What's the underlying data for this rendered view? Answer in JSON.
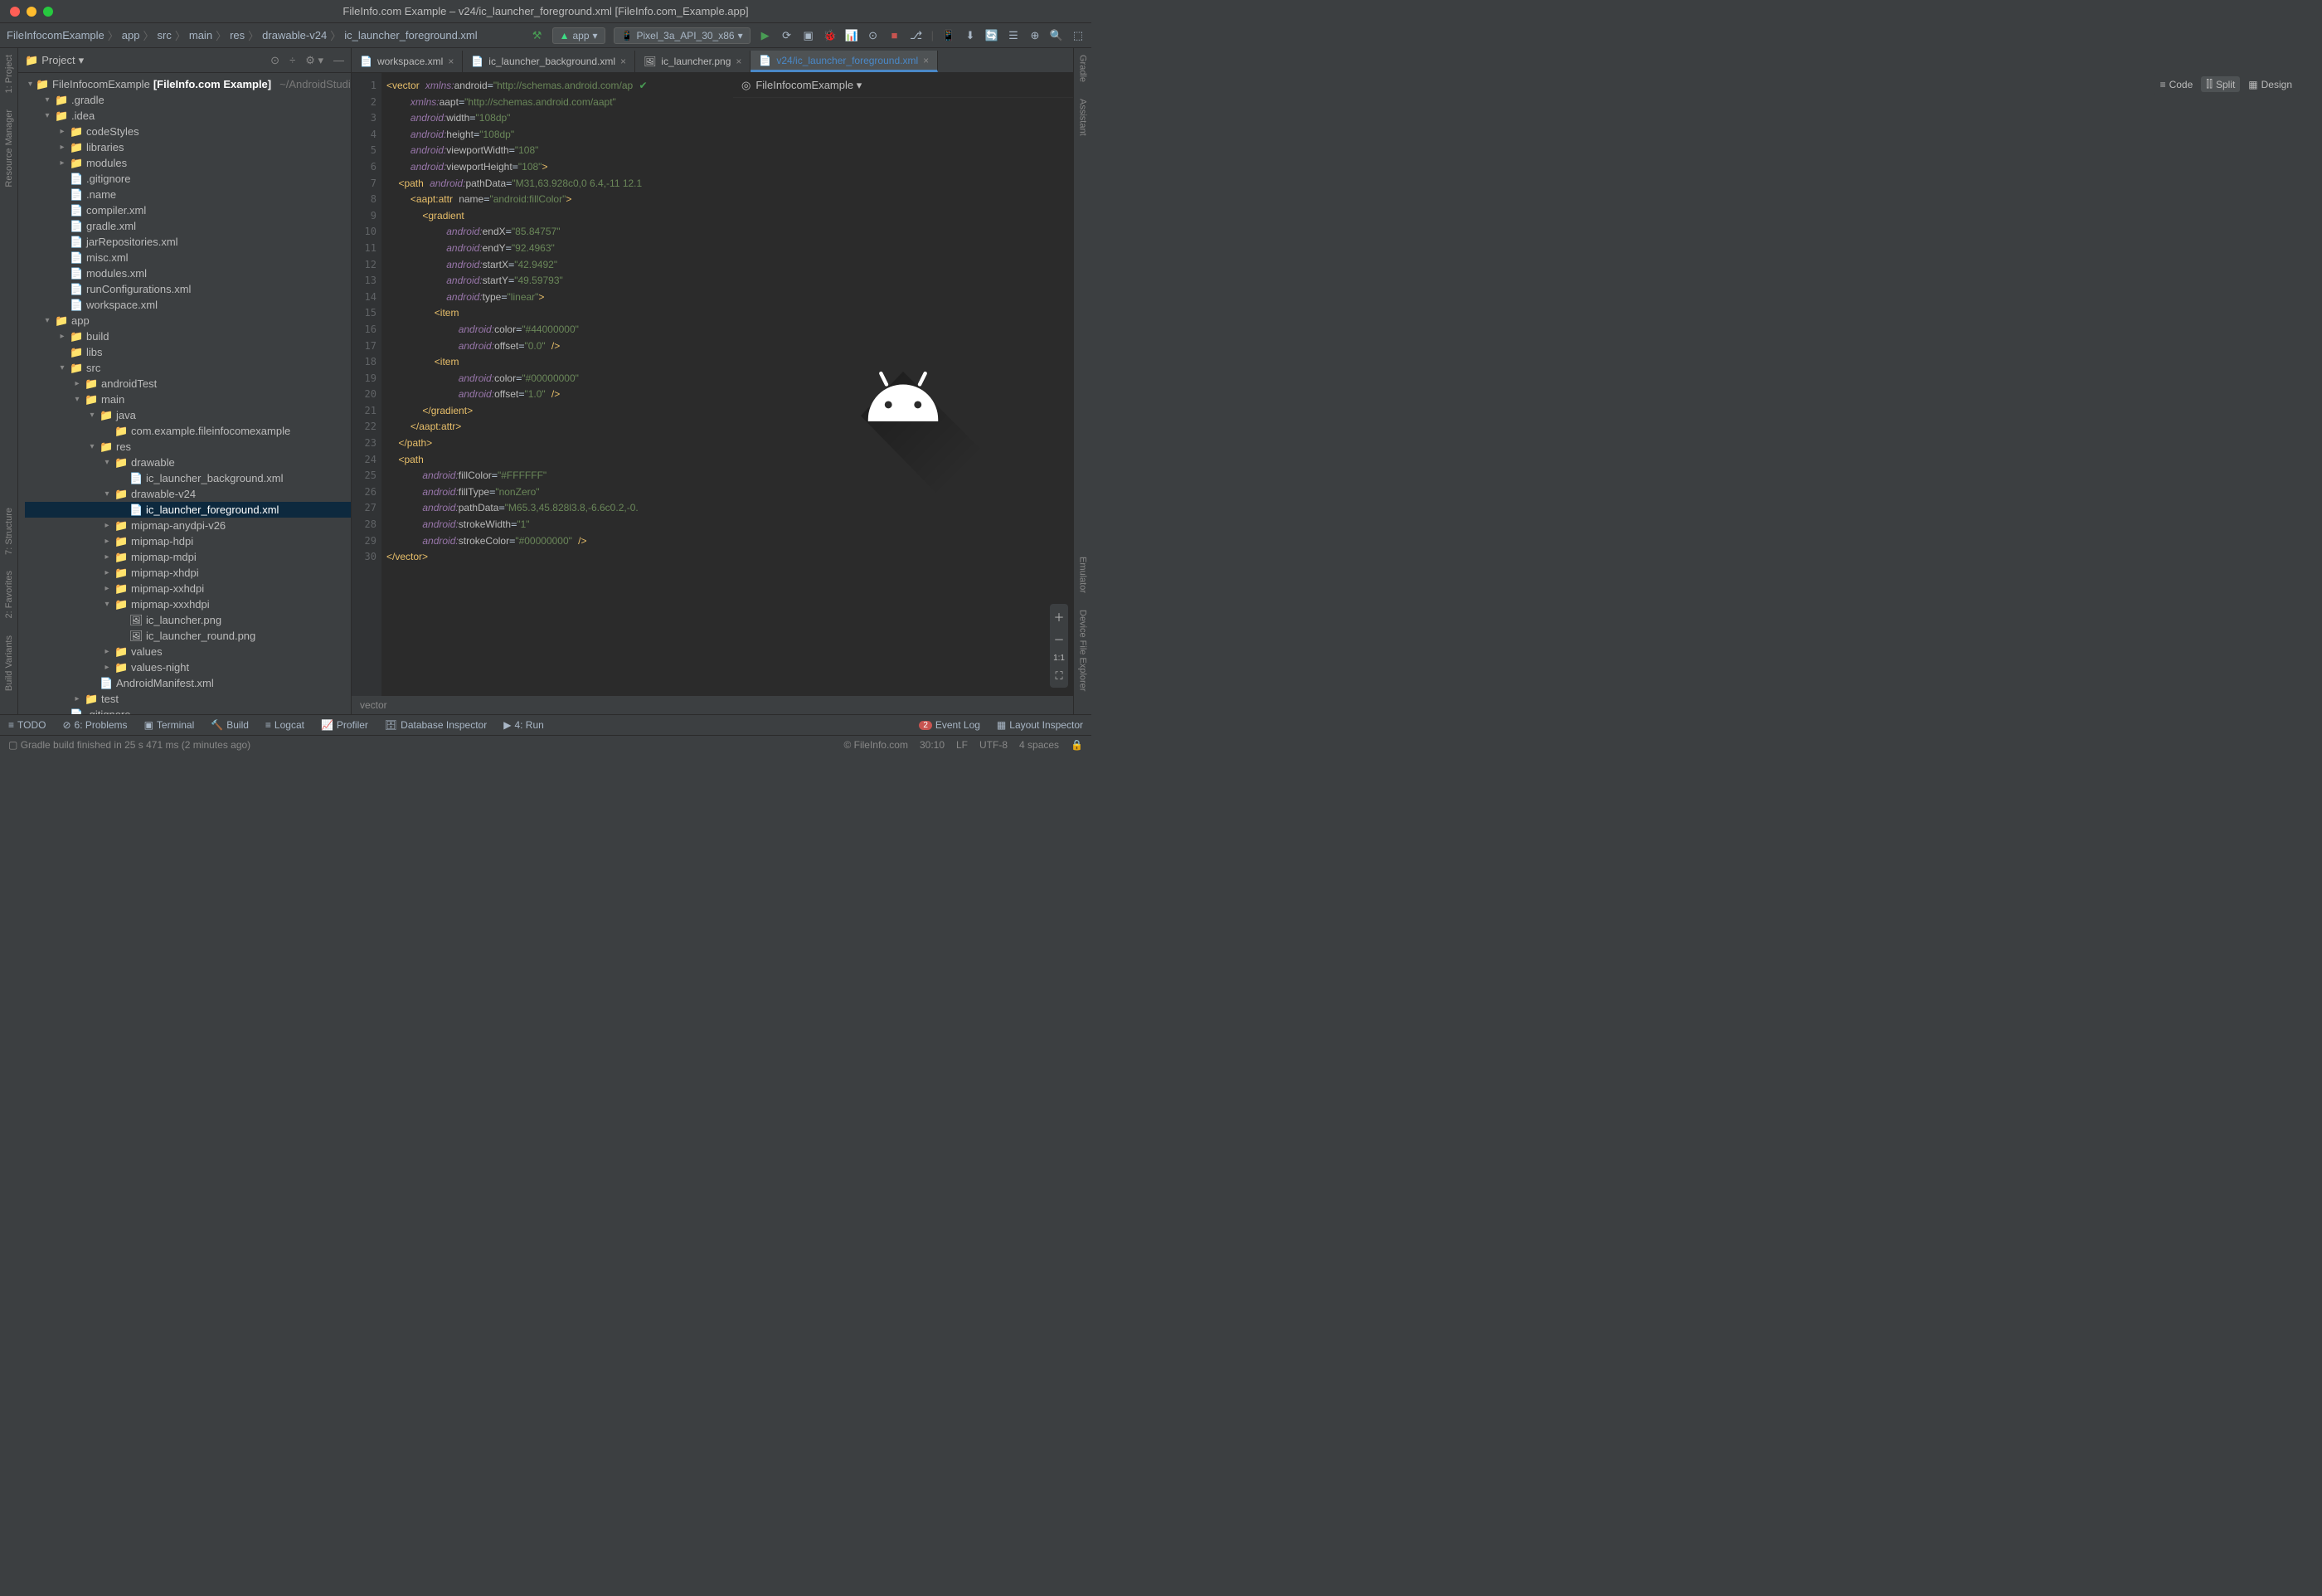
{
  "window_title": "FileInfo.com Example – v24/ic_launcher_foreground.xml [FileInfo.com_Example.app]",
  "breadcrumbs": [
    "FileInfocomExample",
    "app",
    "src",
    "main",
    "res",
    "drawable-v24",
    "ic_launcher_foreground.xml"
  ],
  "runconfig": "app",
  "device": "Pixel_3a_API_30_x86",
  "sidebar_title": "Project",
  "switcher": {
    "code": "Code",
    "split": "Split",
    "design": "Design"
  },
  "project_root": {
    "name": "FileInfocomExample",
    "suffix": "[FileInfo.com Example]",
    "path": "~/AndroidStudioP"
  },
  "tree": [
    {
      "ind": 1,
      "arrow": "▾",
      "ico": "📁",
      "cls": "folder-o",
      "label": ".gradle"
    },
    {
      "ind": 1,
      "arrow": "▾",
      "ico": "📁",
      "cls": "folder",
      "label": ".idea"
    },
    {
      "ind": 2,
      "arrow": "▸",
      "ico": "📁",
      "cls": "folder",
      "label": "codeStyles"
    },
    {
      "ind": 2,
      "arrow": "▸",
      "ico": "📁",
      "cls": "folder",
      "label": "libraries"
    },
    {
      "ind": 2,
      "arrow": "▸",
      "ico": "📁",
      "cls": "folder",
      "label": "modules"
    },
    {
      "ind": 2,
      "arrow": " ",
      "ico": "📄",
      "cls": "",
      "label": ".gitignore"
    },
    {
      "ind": 2,
      "arrow": " ",
      "ico": "📄",
      "cls": "xml",
      "label": ".name"
    },
    {
      "ind": 2,
      "arrow": " ",
      "ico": "📄",
      "cls": "xml",
      "label": "compiler.xml"
    },
    {
      "ind": 2,
      "arrow": " ",
      "ico": "📄",
      "cls": "xml",
      "label": "gradle.xml"
    },
    {
      "ind": 2,
      "arrow": " ",
      "ico": "📄",
      "cls": "xml",
      "label": "jarRepositories.xml"
    },
    {
      "ind": 2,
      "arrow": " ",
      "ico": "📄",
      "cls": "xml",
      "label": "misc.xml"
    },
    {
      "ind": 2,
      "arrow": " ",
      "ico": "📄",
      "cls": "xml",
      "label": "modules.xml"
    },
    {
      "ind": 2,
      "arrow": " ",
      "ico": "📄",
      "cls": "xml",
      "label": "runConfigurations.xml"
    },
    {
      "ind": 2,
      "arrow": " ",
      "ico": "📄",
      "cls": "xml",
      "label": "workspace.xml"
    },
    {
      "ind": 1,
      "arrow": "▾",
      "ico": "📁",
      "cls": "module",
      "label": "app"
    },
    {
      "ind": 2,
      "arrow": "▸",
      "ico": "📁",
      "cls": "folder-o",
      "label": "build"
    },
    {
      "ind": 2,
      "arrow": " ",
      "ico": "📁",
      "cls": "folder",
      "label": "libs"
    },
    {
      "ind": 2,
      "arrow": "▾",
      "ico": "📁",
      "cls": "folder",
      "label": "src"
    },
    {
      "ind": 3,
      "arrow": "▸",
      "ico": "📁",
      "cls": "folder",
      "label": "androidTest"
    },
    {
      "ind": 3,
      "arrow": "▾",
      "ico": "📁",
      "cls": "folder",
      "label": "main"
    },
    {
      "ind": 4,
      "arrow": "▾",
      "ico": "📁",
      "cls": "module",
      "label": "java"
    },
    {
      "ind": 5,
      "arrow": " ",
      "ico": "📁",
      "cls": "folder",
      "label": "com.example.fileinfocomexample"
    },
    {
      "ind": 4,
      "arrow": "▾",
      "ico": "📁",
      "cls": "module",
      "label": "res"
    },
    {
      "ind": 5,
      "arrow": "▾",
      "ico": "📁",
      "cls": "folder",
      "label": "drawable"
    },
    {
      "ind": 6,
      "arrow": " ",
      "ico": "📄",
      "cls": "xml",
      "label": "ic_launcher_background.xml"
    },
    {
      "ind": 5,
      "arrow": "▾",
      "ico": "📁",
      "cls": "folder",
      "label": "drawable-v24"
    },
    {
      "ind": 6,
      "arrow": " ",
      "ico": "📄",
      "cls": "xml",
      "label": "ic_launcher_foreground.xml",
      "sel": true
    },
    {
      "ind": 5,
      "arrow": "▸",
      "ico": "📁",
      "cls": "folder",
      "label": "mipmap-anydpi-v26"
    },
    {
      "ind": 5,
      "arrow": "▸",
      "ico": "📁",
      "cls": "folder",
      "label": "mipmap-hdpi"
    },
    {
      "ind": 5,
      "arrow": "▸",
      "ico": "📁",
      "cls": "folder",
      "label": "mipmap-mdpi"
    },
    {
      "ind": 5,
      "arrow": "▸",
      "ico": "📁",
      "cls": "folder",
      "label": "mipmap-xhdpi"
    },
    {
      "ind": 5,
      "arrow": "▸",
      "ico": "📁",
      "cls": "folder",
      "label": "mipmap-xxhdpi"
    },
    {
      "ind": 5,
      "arrow": "▾",
      "ico": "📁",
      "cls": "folder",
      "label": "mipmap-xxxhdpi"
    },
    {
      "ind": 6,
      "arrow": " ",
      "ico": "🖼",
      "cls": "",
      "label": "ic_launcher.png"
    },
    {
      "ind": 6,
      "arrow": " ",
      "ico": "🖼",
      "cls": "",
      "label": "ic_launcher_round.png"
    },
    {
      "ind": 5,
      "arrow": "▸",
      "ico": "📁",
      "cls": "folder",
      "label": "values"
    },
    {
      "ind": 5,
      "arrow": "▸",
      "ico": "📁",
      "cls": "folder",
      "label": "values-night"
    },
    {
      "ind": 4,
      "arrow": " ",
      "ico": "📄",
      "cls": "xml",
      "label": "AndroidManifest.xml"
    },
    {
      "ind": 3,
      "arrow": "▸",
      "ico": "📁",
      "cls": "folder",
      "label": "test"
    },
    {
      "ind": 2,
      "arrow": " ",
      "ico": "📄",
      "cls": "",
      "label": ".gitignore"
    }
  ],
  "tabs": [
    {
      "name": "workspace.xml",
      "ico": "📄"
    },
    {
      "name": "ic_launcher_background.xml",
      "ico": "📄"
    },
    {
      "name": "ic_launcher.png",
      "ico": "🖼"
    },
    {
      "name": "v24/ic_launcher_foreground.xml",
      "ico": "📄",
      "active": true,
      "mod": true
    }
  ],
  "line_count": 30,
  "code_lines": [
    "<span class='tag'>&lt;vector</span> <span class='an'>xmlns:</span><span class='attr'>android</span>=<span class='val'>\"http://schemas.android.com/ap</span> <span style='color:#499c54'>✔</span>",
    "    <span class='an'>xmlns:</span><span class='attr'>aapt</span>=<span class='val'>\"http://schemas.android.com/aapt\"</span>",
    "    <span class='an'>android:</span><span class='attr'>width</span>=<span class='val'>\"108dp\"</span>",
    "    <span class='an'>android:</span><span class='attr'>height</span>=<span class='val'>\"108dp\"</span>",
    "    <span class='an'>android:</span><span class='attr'>viewportWidth</span>=<span class='val'>\"108\"</span>",
    "    <span class='an'>android:</span><span class='attr'>viewportHeight</span>=<span class='val'>\"108\"</span><span class='tag'>&gt;</span>",
    "  <span class='tag'>&lt;path</span> <span class='an'>android:</span><span class='attr'>pathData</span>=<span class='val'>\"M31,63.928c0,0 6.4,-11 12.1</span>",
    "    <span class='tag'>&lt;aapt:attr</span> <span class='attr'>name</span>=<span class='val'>\"android:fillColor\"</span><span class='tag'>&gt;</span>",
    "      <span class='tag'>&lt;gradient</span>",
    "          <span class='an'>android:</span><span class='attr'>endX</span>=<span class='val'>\"85.84757\"</span>",
    "          <span class='an'>android:</span><span class='attr'>endY</span>=<span class='val'>\"92.4963\"</span>",
    "          <span class='an'>android:</span><span class='attr'>startX</span>=<span class='val'>\"42.9492\"</span>",
    "          <span class='an'>android:</span><span class='attr'>startY</span>=<span class='val'>\"49.59793\"</span>",
    "          <span class='an'>android:</span><span class='attr'>type</span>=<span class='val'>\"linear\"</span><span class='tag'>&gt;</span>",
    "        <span class='tag'>&lt;item</span>",
    "            <span class='an'>android:</span><span class='attr'>color</span>=<span class='val'>\"#44000000\"</span>",
    "            <span class='an'>android:</span><span class='attr'>offset</span>=<span class='val'>\"0.0\"</span> <span class='tag'>/&gt;</span>",
    "        <span class='tag'>&lt;item</span>",
    "            <span class='an'>android:</span><span class='attr'>color</span>=<span class='val'>\"#00000000\"</span>",
    "            <span class='an'>android:</span><span class='attr'>offset</span>=<span class='val'>\"1.0\"</span> <span class='tag'>/&gt;</span>",
    "      <span class='tag'>&lt;/gradient&gt;</span>",
    "    <span class='tag'>&lt;/aapt:attr&gt;</span>",
    "  <span class='tag'>&lt;/path&gt;</span>",
    "  <span class='tag'>&lt;path</span>",
    "      <span class='an'>android:</span><span class='attr'>fillColor</span>=<span class='val'>\"#FFFFFF\"</span>",
    "      <span class='an'>android:</span><span class='attr'>fillType</span>=<span class='val'>\"nonZero\"</span>",
    "      <span class='an'>android:</span><span class='attr'>pathData</span>=<span class='val'>\"M65.3,45.828l3.8,-6.6c0.2,-0.</span>",
    "      <span class='an'>android:</span><span class='attr'>strokeWidth</span>=<span class='val'>\"1\"</span>",
    "      <span class='an'>android:</span><span class='attr'>strokeColor</span>=<span class='val'>\"#00000000\"</span> <span class='tag'>/&gt;</span>",
    "<span class='tag'>&lt;/vector&gt;</span>"
  ],
  "editor_breadcrumb": "vector",
  "preview_combo": "FileInfocomExample",
  "footer": {
    "todo": "TODO",
    "problems": "6: Problems",
    "terminal": "Terminal",
    "build": "Build",
    "logcat": "Logcat",
    "profiler": "Profiler",
    "db": "Database Inspector",
    "run": "4: Run",
    "event": "Event Log",
    "layout": "Layout Inspector",
    "notif": "2"
  },
  "status_msg": "Gradle build finished in 25 s 471 ms (2 minutes ago)",
  "status_right": {
    "brand": "© FileInfo.com",
    "pos": "30:10",
    "le": "LF",
    "enc": "UTF-8",
    "indent": "4 spaces"
  },
  "left_stripe": [
    "1: Project",
    "Resource Manager"
  ],
  "left_stripe_bottom": [
    "7: Structure",
    "2: Favorites",
    "Build Variants"
  ],
  "right_stripe": [
    "Gradle",
    "Assistant"
  ],
  "right_stripe_bottom": [
    "Emulator",
    "Device File Explorer"
  ]
}
